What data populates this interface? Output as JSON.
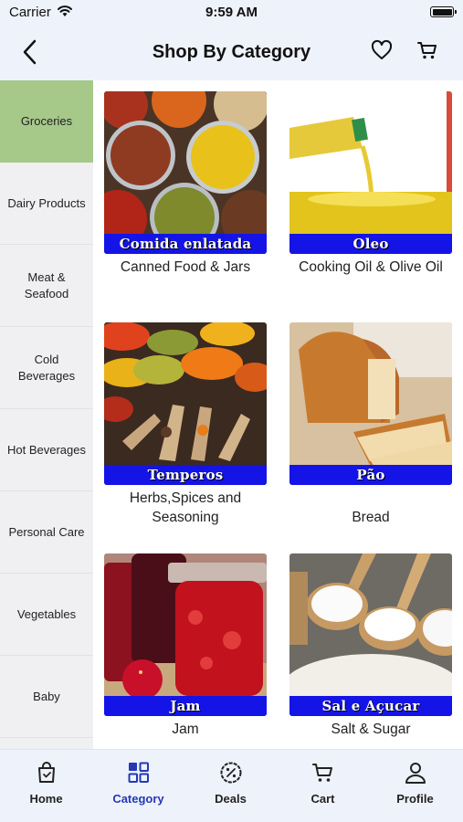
{
  "status_bar": {
    "carrier": "Carrier",
    "time": "9:59 AM"
  },
  "header": {
    "title": "Shop By Category",
    "icons": [
      "back-chevron-icon",
      "heart-icon",
      "cart-icon"
    ]
  },
  "sidebar": {
    "active_color": "#a6c98a",
    "items": [
      {
        "label": "Groceries",
        "active": true
      },
      {
        "label": "Dairy Products",
        "active": false
      },
      {
        "label": "Meat & Seafood",
        "active": false
      },
      {
        "label": "Cold Beverages",
        "active": false
      },
      {
        "label": "Hot Beverages",
        "active": false
      },
      {
        "label": "Personal Care",
        "active": false
      },
      {
        "label": "Vegetables",
        "active": false
      },
      {
        "label": "Baby",
        "active": false
      }
    ]
  },
  "categories": [
    {
      "banner": "Comida enlatada",
      "label": "Canned Food & Jars"
    },
    {
      "banner": "Oleo",
      "label": "Cooking Oil & Olive Oil"
    },
    {
      "banner": "Temperos",
      "label": "Herbs,Spices and Seasoning"
    },
    {
      "banner": "Pão",
      "label": "Bread"
    },
    {
      "banner": "Jam",
      "label": "Jam"
    },
    {
      "banner": "Sal e Açucar",
      "label": "Salt & Sugar"
    }
  ],
  "banner_color": "#1414e6",
  "tab_bar": {
    "accent": "#2438b8",
    "tabs": [
      {
        "label": "Home",
        "icon": "shopping-bag-icon",
        "active": false
      },
      {
        "label": "Category",
        "icon": "grid-icon",
        "active": true
      },
      {
        "label": "Deals",
        "icon": "discount-badge-icon",
        "active": false
      },
      {
        "label": "Cart",
        "icon": "cart-icon",
        "active": false
      },
      {
        "label": "Profile",
        "icon": "person-icon",
        "active": false
      }
    ]
  }
}
